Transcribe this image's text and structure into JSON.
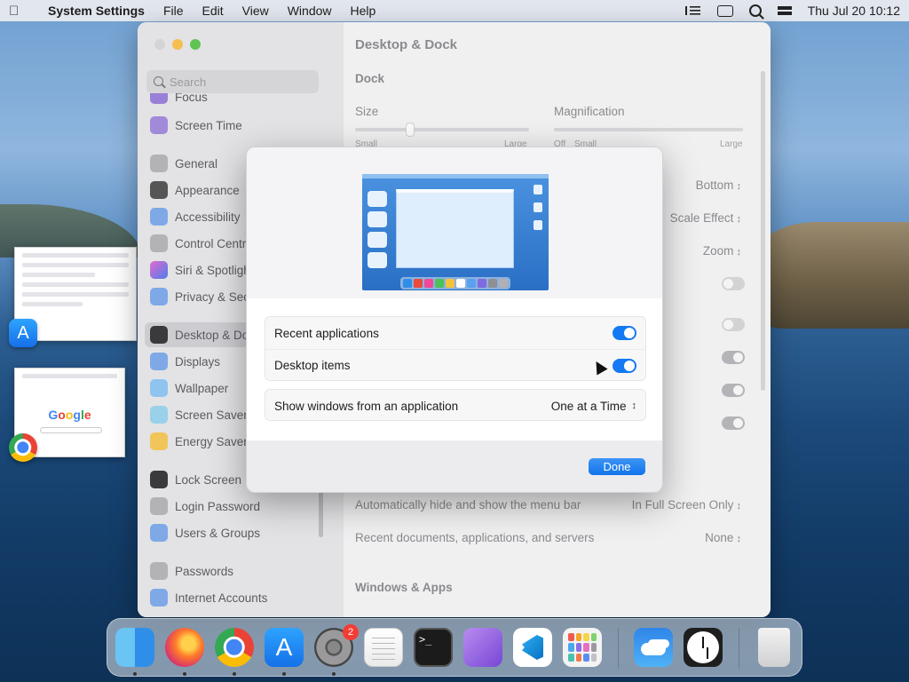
{
  "menubar": {
    "app_name": "System Settings",
    "items": [
      "File",
      "Edit",
      "View",
      "Window",
      "Help"
    ],
    "clock": "Thu Jul 20  10:12"
  },
  "settings": {
    "search_placeholder": "Search",
    "sidebar": [
      {
        "label": "Focus"
      },
      {
        "label": "Screen Time"
      },
      {
        "label": "General"
      },
      {
        "label": "Appearance"
      },
      {
        "label": "Accessibility"
      },
      {
        "label": "Control Centre"
      },
      {
        "label": "Siri & Spotlight"
      },
      {
        "label": "Privacy & Security"
      },
      {
        "label": "Desktop & Dock"
      },
      {
        "label": "Displays"
      },
      {
        "label": "Wallpaper"
      },
      {
        "label": "Screen Saver"
      },
      {
        "label": "Energy Saver"
      },
      {
        "label": "Lock Screen"
      },
      {
        "label": "Login Password"
      },
      {
        "label": "Users & Groups"
      },
      {
        "label": "Passwords"
      },
      {
        "label": "Internet Accounts"
      }
    ],
    "content": {
      "title": "Desktop & Dock",
      "dock_section": "Dock",
      "size_label": "Size",
      "size_small": "Small",
      "size_large": "Large",
      "magnification_label": "Magnification",
      "mag_off": "Off",
      "mag_small": "Small",
      "mag_large": "Large",
      "position_value": "Bottom",
      "minimize_value": "Scale Effect",
      "double_click_value": "Zoom",
      "menu_bar_label": "Automatically hide and show the menu bar",
      "menu_bar_value": "In Full Screen Only",
      "recent_docs_label": "Recent documents, applications, and servers",
      "recent_docs_value": "None",
      "windows_section": "Windows & Apps"
    }
  },
  "modal": {
    "row1_label": "Recent applications",
    "row2_label": "Desktop items",
    "row3_label": "Show windows from an application",
    "row3_value": "One at a Time",
    "done_label": "Done"
  },
  "thumb_google": "Google",
  "dock": {
    "settings_badge": "2",
    "terminal_prompt": ">_"
  },
  "icons": [
    "apple-icon",
    "search-icon",
    "control-centre-icon",
    "finder-icon",
    "firefox-icon",
    "chrome-icon",
    "app-store-icon",
    "system-settings-icon",
    "textedit-icon",
    "terminal-icon",
    "visual-studio-icon",
    "vscode-icon",
    "launchpad-icon",
    "weather-icon",
    "clock-icon",
    "trash-icon"
  ],
  "colors": {
    "accent": "#1479f2",
    "badge": "#f43c34"
  }
}
